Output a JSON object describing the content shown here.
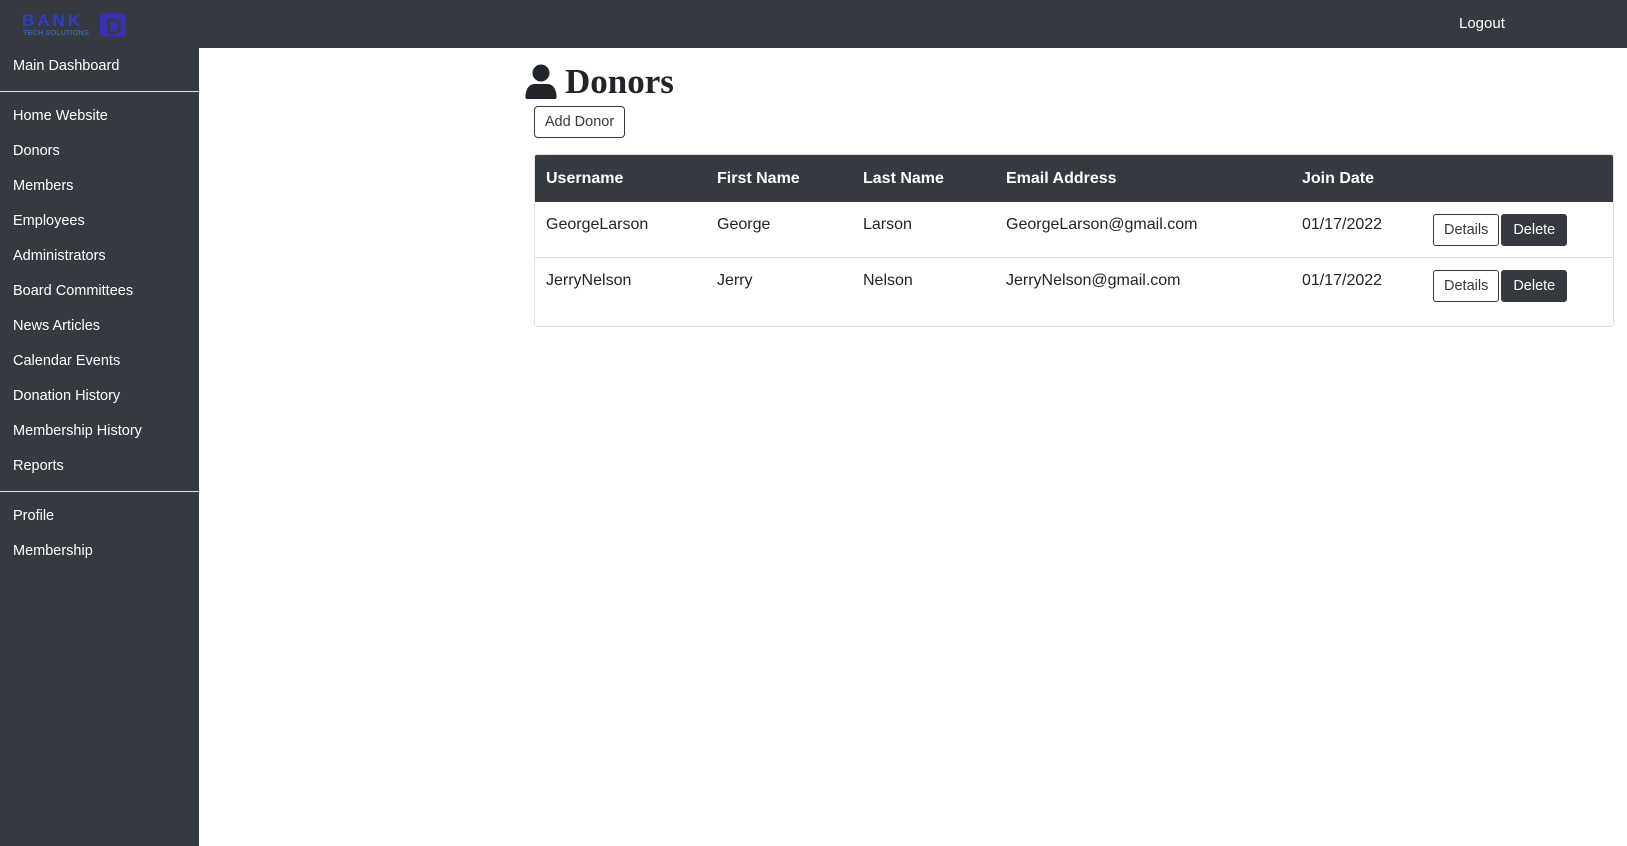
{
  "header": {
    "logo_text": "BANK D TECH SOLUTIONS",
    "logout": "Logout"
  },
  "sidebar": {
    "items": [
      {
        "label": "Main Dashboard"
      },
      {
        "label": "Home Website"
      },
      {
        "label": "Donors"
      },
      {
        "label": "Members"
      },
      {
        "label": "Employees"
      },
      {
        "label": "Administrators"
      },
      {
        "label": "Board Committees"
      },
      {
        "label": "News Articles"
      },
      {
        "label": "Calendar Events"
      },
      {
        "label": "Donation History"
      },
      {
        "label": "Membership History"
      },
      {
        "label": "Reports"
      },
      {
        "label": "Profile"
      },
      {
        "label": "Membership"
      }
    ]
  },
  "page": {
    "title": "Donors",
    "icon": "user-icon",
    "add_button": "Add Donor"
  },
  "table": {
    "headers": [
      "Username",
      "First Name",
      "Last Name",
      "Email Address",
      "Join Date",
      ""
    ],
    "rows": [
      {
        "username": "GeorgeLarson",
        "first": "George",
        "last": "Larson",
        "email": "GeorgeLarson@gmail.com",
        "join": "01/17/2022",
        "details": "Details",
        "delete": "Delete"
      },
      {
        "username": "JerryNelson",
        "first": "Jerry",
        "last": "Nelson",
        "email": "JerryNelson@gmail.com",
        "join": "01/17/2022",
        "details": "Details",
        "delete": "Delete"
      }
    ]
  }
}
